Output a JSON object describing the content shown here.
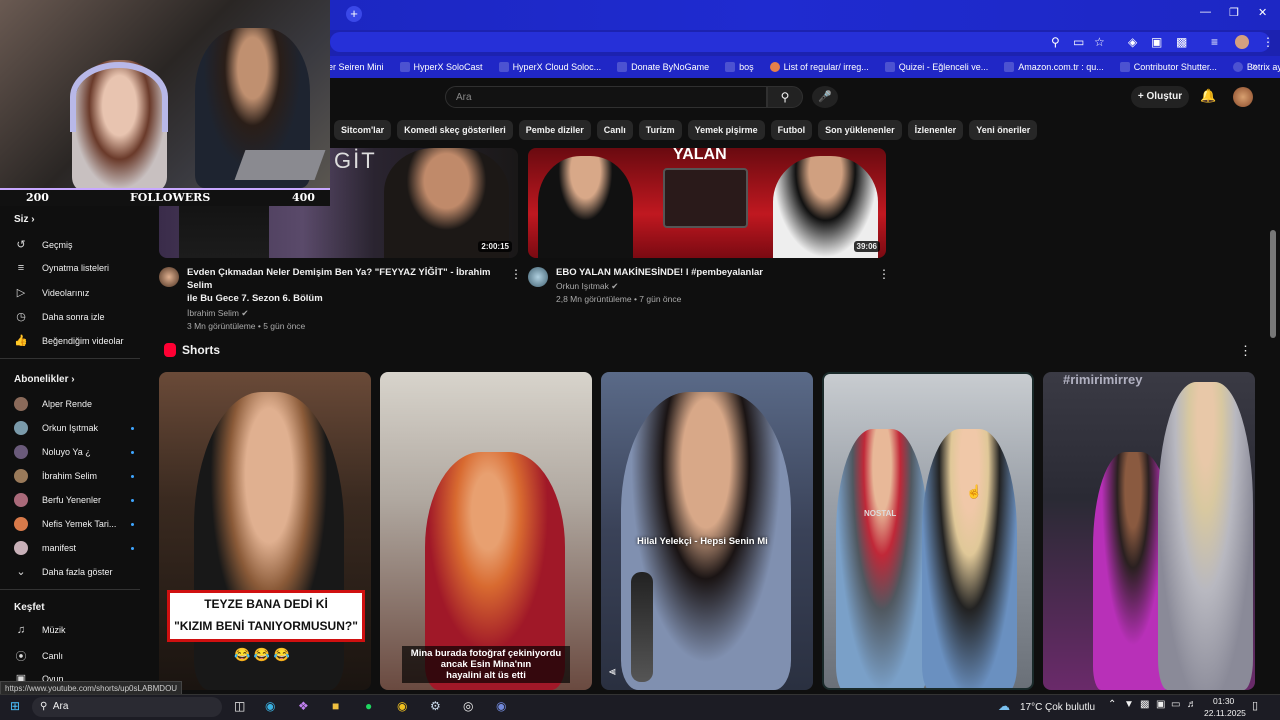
{
  "browser": {
    "bookmarks": [
      "er Seiren Mini",
      "HyperX SoloCast",
      "HyperX Cloud Soloc...",
      "Donate ByNoGame",
      "boş",
      "List of regular/ irreg...",
      "Quizei - Eğlenceli ve...",
      "Amazon.com.tr : qu...",
      "Contributor Shutter...",
      "Botrix ayarları nasıl..."
    ],
    "status_url": "https://www.youtube.com/shorts/up0sLABMDOU"
  },
  "header": {
    "search_placeholder": "Ara",
    "create_label": "Oluştur"
  },
  "chips": [
    "Sitcom'lar",
    "Komedi skeç gösterileri",
    "Pembe diziler",
    "Canlı",
    "Turizm",
    "Yemek pişirme",
    "Futbol",
    "Son yüklenenler",
    "İzlenenler",
    "Yeni öneriler"
  ],
  "overlay": {
    "left_count": "200",
    "label": "FOLLOWERS",
    "right_count": "400"
  },
  "sidebar": {
    "you_heading": "Siz",
    "you_items": [
      "Geçmiş",
      "Oynatma listeleri",
      "Videolarınız",
      "Daha sonra izle",
      "Beğendiğim videolar"
    ],
    "subs_heading": "Abonelikler",
    "subs": [
      "Alper Rende",
      "Orkun Işıtmak",
      "Noluyo Ya ¿",
      "İbrahim Selim",
      "Berfu Yenenler",
      "Nefis Yemek Tari...",
      "manifest"
    ],
    "show_more": "Daha fazla göster",
    "explore_heading": "Keşfet",
    "explore_items": [
      "Müzik",
      "Canlı",
      "Oyun"
    ]
  },
  "videos": [
    {
      "thumb_text": "GİT",
      "duration": "2:00:15",
      "title_line1": "Evden Çıkmadan Neler Demişim Ben Ya? \"FEYYAZ YİĞİT\" - İbrahim Selim",
      "title_line2": "ile Bu Gece 7. Sezon 6. Bölüm",
      "channel": "İbrahim Selim",
      "meta": "3 Mn görüntüleme • 5 gün önce"
    },
    {
      "thumb_text": "YALAN",
      "duration": "39:06",
      "title_line1": "EBO YALAN MAKİNESİNDE! l #pembeyalanlar",
      "title_line2": "",
      "channel": "Orkun Işıtmak",
      "meta": "2,8 Mn görüntüleme • 7 gün önce"
    }
  ],
  "shorts": {
    "heading": "Shorts",
    "items": [
      {
        "caption_line1": "TEYZE BANA DEDİ Kİ",
        "caption_line2": "\"KIZIM BENİ TANIYORMUSUN?\"",
        "emoji": "😂 😂 😂"
      },
      {
        "caption_line1": "Mina burada fotoğraf çekiniyordu",
        "caption_line2": "ancak Esin Mina'nın",
        "caption_line3": "hayalini alt üs etti"
      },
      {
        "caption_line1": "Hilal Yelekçi - Hepsi Senin Mi"
      },
      {
        "shirt_text": "NOSTAL"
      },
      {
        "hashtag": "#rimirimirrey"
      }
    ]
  },
  "taskbar": {
    "search_label": "Ara",
    "weather_temp": "17°C",
    "weather_text": "Çok bulutlu",
    "time": "01:30",
    "date": "22.11.2025"
  }
}
